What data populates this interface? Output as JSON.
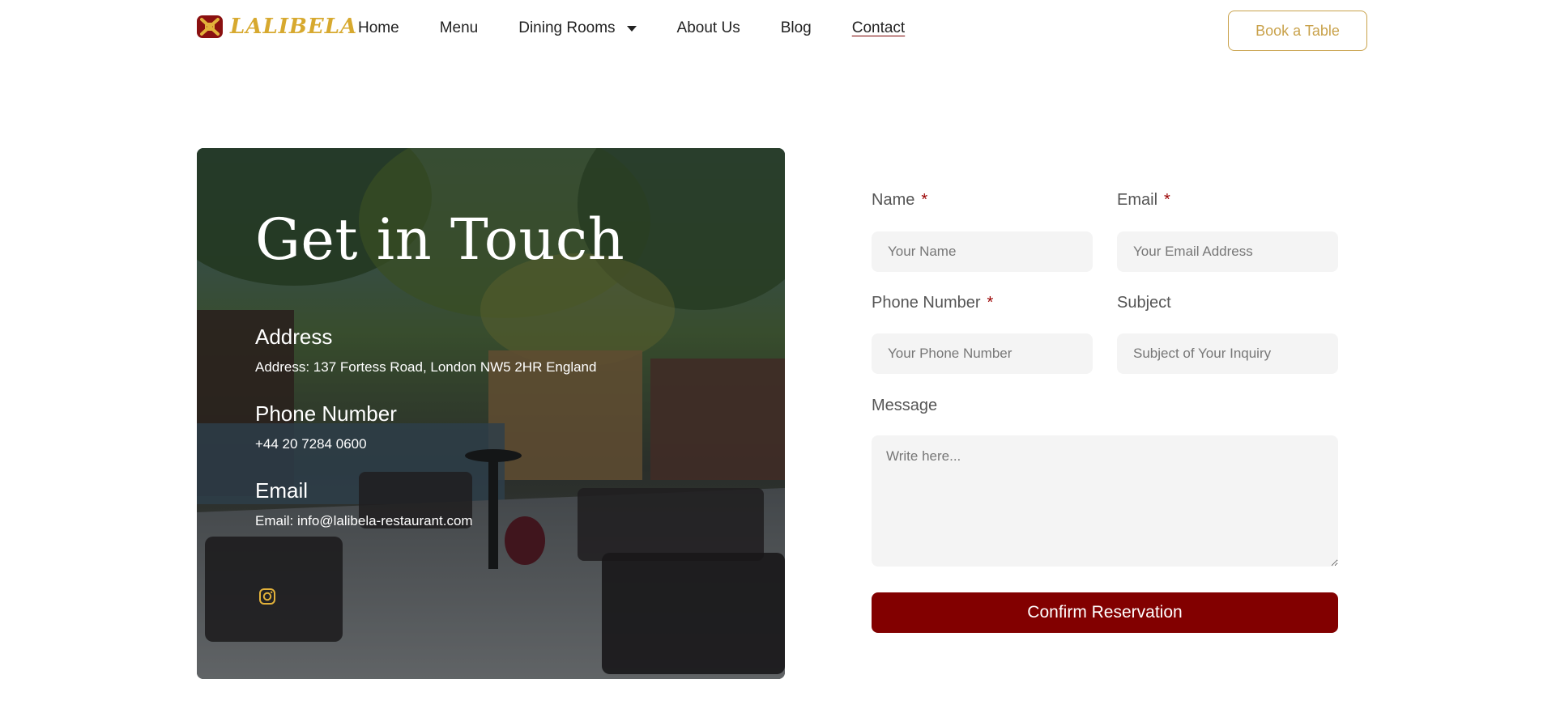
{
  "brand": {
    "name": "LALIBELA",
    "accent_color": "#d7a92f",
    "primary_color": "#820000"
  },
  "nav": {
    "items": [
      {
        "label": "Home"
      },
      {
        "label": "Menu"
      },
      {
        "label": "Dining Rooms",
        "has_dropdown": true
      },
      {
        "label": "About Us"
      },
      {
        "label": "Blog"
      },
      {
        "label": "Contact",
        "active": true
      }
    ],
    "cta_label": "Book a Table"
  },
  "contact_card": {
    "title": "Get in Touch",
    "address_heading": "Address",
    "address_text": "Address: 137 Fortess Road, London NW5 2HR England",
    "phone_heading": "Phone Number",
    "phone_text": "+44 20 7284 0600",
    "email_heading": "Email",
    "email_text": "Email: info@lalibela-restaurant.com",
    "social_icon": "instagram-icon"
  },
  "form": {
    "name_label": "Name",
    "name_placeholder": "Your Name",
    "email_label": "Email",
    "email_placeholder": "Your Email Address",
    "phone_label": "Phone Number",
    "phone_placeholder": "Your Phone Number",
    "subject_label": "Subject",
    "subject_placeholder": "Subject of Your Inquiry",
    "message_label": "Message",
    "message_placeholder": "Write here...",
    "required_mark": "*",
    "submit_label": "Confirm Reservation"
  }
}
